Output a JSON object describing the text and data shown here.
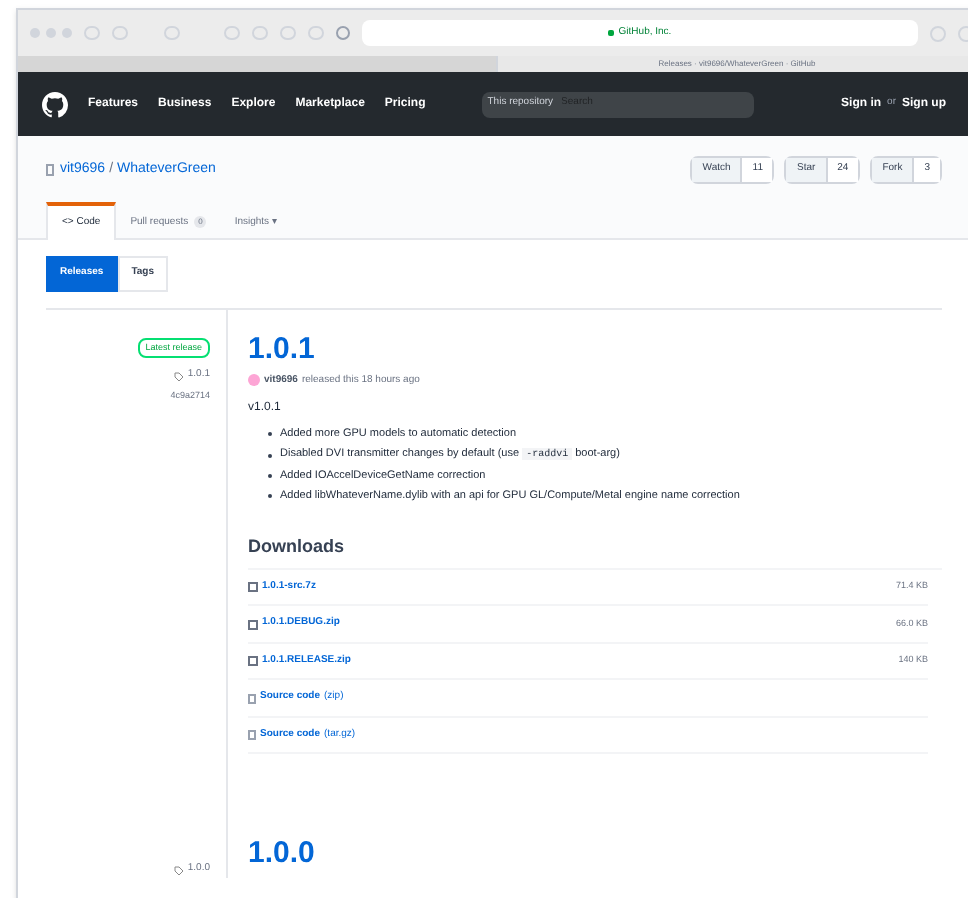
{
  "browser": {
    "address": "GitHub, Inc.",
    "tabs": [
      {
        "selected": false
      },
      {
        "title": "Releases · vit9696/WhateverGreen · GitHub",
        "selected": true
      }
    ]
  },
  "header": {
    "nav": [
      "Features",
      "Business",
      "Explore",
      "Marketplace",
      "Pricing"
    ],
    "search_scope": "This repository",
    "search_placeholder": "Search",
    "sign_in": "Sign in",
    "or": "or",
    "sign_up": "Sign up"
  },
  "repo": {
    "owner": "vit9696",
    "separator": "/",
    "name": "WhateverGreen",
    "actions": [
      {
        "label": "Watch",
        "count": "11"
      },
      {
        "label": "Star",
        "count": "24"
      },
      {
        "label": "Fork",
        "count": "3"
      }
    ],
    "tabs": [
      {
        "label": "<> Code",
        "selected": true
      },
      {
        "label": "Pull requests",
        "count": "0",
        "selected": false
      },
      {
        "label": "Insights ▾",
        "selected": false
      }
    ]
  },
  "subnav": [
    {
      "label": "Releases",
      "selected": true
    },
    {
      "label": "Tags",
      "selected": false
    }
  ],
  "releases": [
    {
      "latest": true,
      "latest_label": "Latest release",
      "tag": "1.0.1",
      "commit": "4c9a2714",
      "title": "1.0.1",
      "author": "vit9696",
      "meta": "released this 18 hours ago",
      "subtitle": "v1.0.1",
      "notes": [
        {
          "text": "Added more GPU models to automatic detection"
        },
        {
          "text": "Disabled DVI transmitter changes by default (use",
          "code": "-raddvi",
          "after": "boot-arg)"
        },
        {
          "text": "Added IOAccelDeviceGetName correction"
        },
        {
          "text": "Added libWhateverName.dylib with an api for GPU GL/Compute/Metal engine name correction"
        }
      ],
      "downloads_title": "Downloads",
      "downloads": [
        {
          "kind": "asset",
          "name": "1.0.1-src.7z",
          "size": "71.4 KB"
        },
        {
          "kind": "asset",
          "name": "1.0.1.DEBUG.zip",
          "size": "66.0 KB"
        },
        {
          "kind": "asset",
          "name": "1.0.1.RELEASE.zip",
          "size": "140 KB"
        },
        {
          "kind": "source",
          "name": "Source code",
          "suffix": "(zip)"
        },
        {
          "kind": "source",
          "name": "Source code",
          "suffix": "(tar.gz)"
        }
      ]
    },
    {
      "latest": false,
      "tag": "1.0.0",
      "title": "1.0.0"
    }
  ]
}
